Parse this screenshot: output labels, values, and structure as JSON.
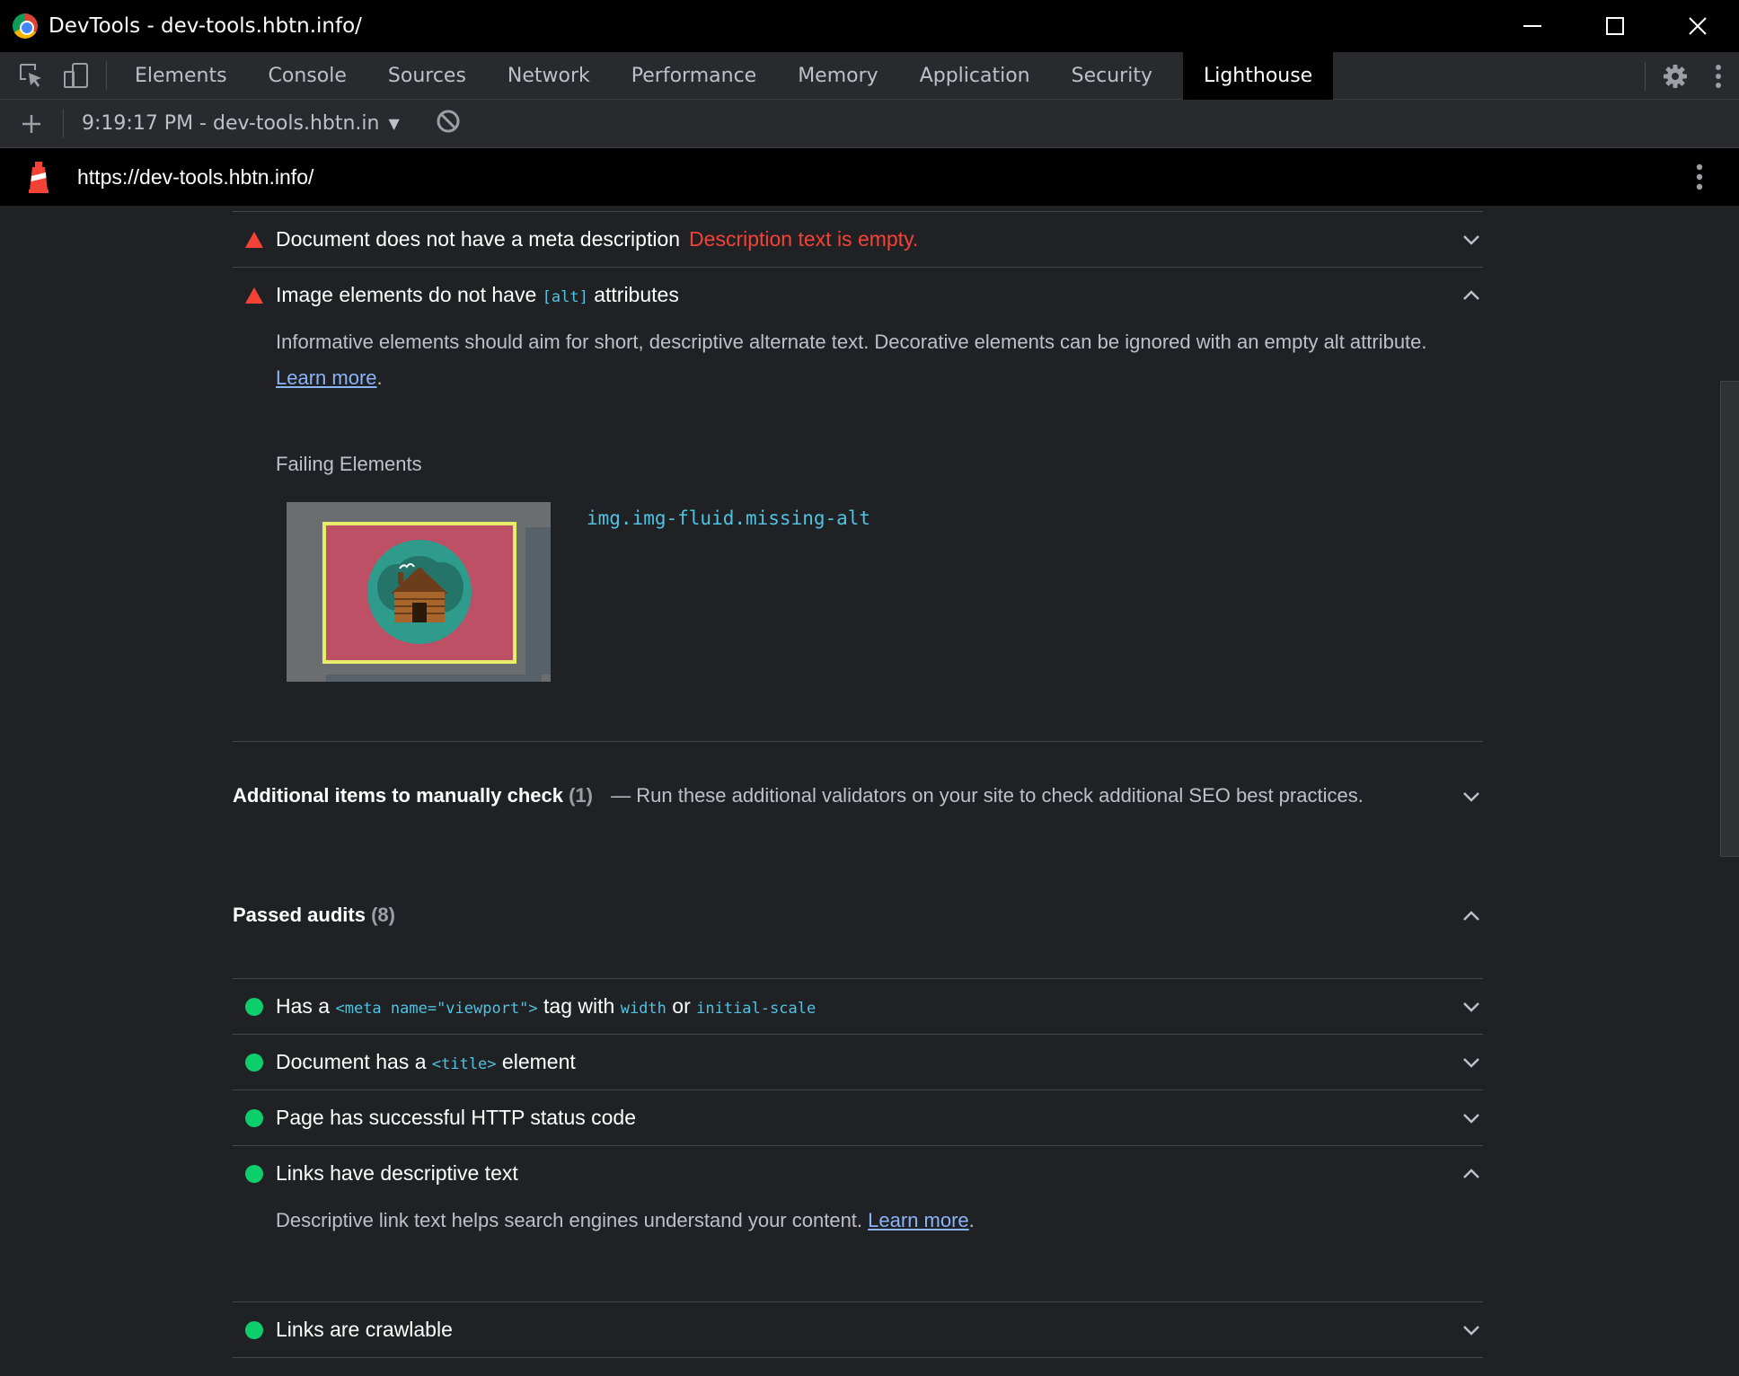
{
  "window": {
    "title": "DevTools - dev-tools.hbtn.info/"
  },
  "tabs": [
    {
      "label": "Elements"
    },
    {
      "label": "Console"
    },
    {
      "label": "Sources"
    },
    {
      "label": "Network"
    },
    {
      "label": "Performance"
    },
    {
      "label": "Memory"
    },
    {
      "label": "Application"
    },
    {
      "label": "Security"
    },
    {
      "label": "Lighthouse"
    }
  ],
  "report_toolbar": {
    "report_label": "9:19:17 PM - dev-tools.hbtn.in"
  },
  "url_bar": {
    "url": "https://dev-tools.hbtn.info/"
  },
  "audits_failed": [
    {
      "status": "fail",
      "title": "Document does not have a meta description",
      "error": "Description text is empty.",
      "expanded": false
    },
    {
      "status": "fail",
      "title_before": "Image elements do not have",
      "title_code": "[alt]",
      "title_after": "attributes",
      "expanded": true,
      "description": "Informative elements should aim for short, descriptive alternate text. Decorative elements can be ignored with an empty alt attribute.",
      "learn_more": "Learn more",
      "failing_label": "Failing Elements",
      "failing_selector": "img.img-fluid.missing-alt"
    }
  ],
  "manual": {
    "title": "Additional items to manually check",
    "count": "(1)",
    "dash": "—",
    "description": "Run these additional validators on your site to check additional SEO best practices."
  },
  "passed": {
    "title": "Passed audits",
    "count": "(8)",
    "items": [
      {
        "parts": [
          "Has a",
          "<meta name=\"viewport\">",
          "tag with",
          "width",
          "or",
          "initial-scale"
        ],
        "expanded": false
      },
      {
        "parts": [
          "Document has a",
          "<title>",
          "element"
        ],
        "expanded": false
      },
      {
        "title": "Page has successful HTTP status code",
        "expanded": false
      },
      {
        "title": "Links have descriptive text",
        "expanded": true,
        "description": "Descriptive link text helps search engines understand your content.",
        "learn_more": "Learn more"
      },
      {
        "title": "Links are crawlable",
        "expanded": false
      }
    ]
  },
  "colors": {
    "fail": "#f44336",
    "pass": "#0cce6b",
    "code": "#4fc3e1",
    "link": "#8ab4f8",
    "background": "#202124"
  },
  "icons": [
    "inspect-icon",
    "device-toolbar-icon",
    "settings-icon",
    "kebab-menu-icon",
    "plus-icon",
    "clear-icon",
    "lighthouse-icon",
    "chevron-down-icon",
    "chevron-up-icon",
    "minimize-icon",
    "maximize-icon",
    "close-icon"
  ]
}
